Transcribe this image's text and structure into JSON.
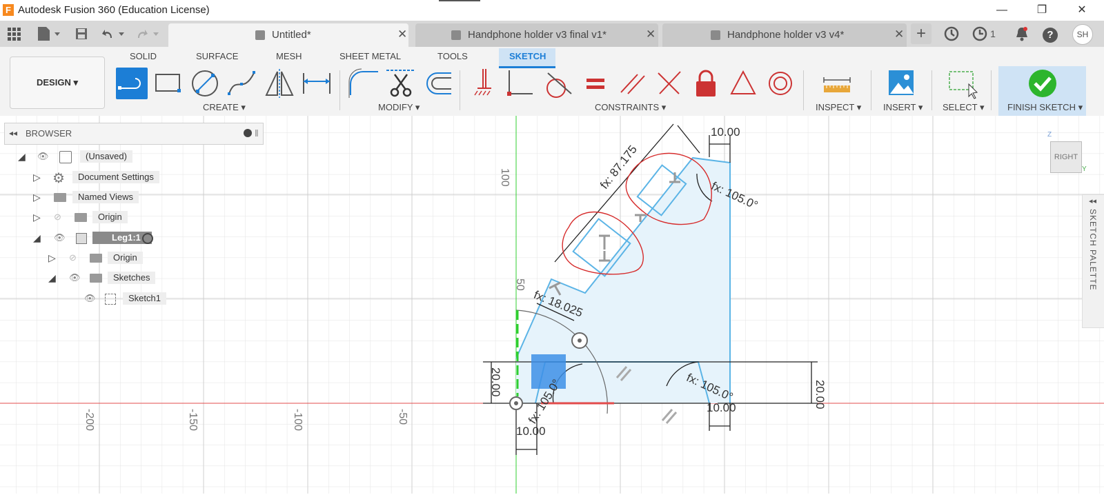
{
  "window": {
    "logo_letter": "F",
    "title": "Autodesk Fusion 360 (Education License)",
    "minimize": "—",
    "restore": "❐",
    "close": "✕"
  },
  "tabs": [
    {
      "label": "Untitled*",
      "active": true
    },
    {
      "label": "Handphone holder v3 final v1*",
      "active": false
    },
    {
      "label": "Handphone holder v3 v4*",
      "active": false
    }
  ],
  "tab_close": "✕",
  "right_icons": {
    "add": "+",
    "jobs_count": "1",
    "user_initials": "SH",
    "help": "?"
  },
  "workspace_button": "DESIGN ▾",
  "ribbon_tabs": [
    "SOLID",
    "SURFACE",
    "MESH",
    "SHEET METAL",
    "TOOLS",
    "SKETCH"
  ],
  "groups": {
    "create": "CREATE ▾",
    "modify": "MODIFY ▾",
    "constraints": "CONSTRAINTS ▾",
    "inspect": "INSPECT ▾",
    "insert": "INSERT ▾",
    "select": "SELECT ▾",
    "finish": "FINISH SKETCH ▾"
  },
  "browser": {
    "title": "BROWSER",
    "nodes": [
      {
        "label": "(Unsaved)"
      },
      {
        "label": "Document Settings"
      },
      {
        "label": "Named Views"
      },
      {
        "label": "Origin"
      },
      {
        "label": "Leg1:1"
      },
      {
        "label": "Origin"
      },
      {
        "label": "Sketches"
      },
      {
        "label": "Sketch1"
      }
    ]
  },
  "viewcube_label": "RIGHT",
  "viewcube_axes": {
    "z": "Z",
    "y": "Y"
  },
  "sketch_palette": "SKETCH PALETTE",
  "axis_labels": {
    "v100": "100",
    "v50": "50",
    "h_200": "-200",
    "h_150": "-150",
    "h_100": "-100",
    "h_50": "-50"
  },
  "dimensions": {
    "d_top_width": "10.00",
    "d_length": "fx: 87.175",
    "d_angle_top": "fx: 105.0°",
    "d_short": "fx: 18.025",
    "d_height_left": "20.00",
    "d_height_right": "20.00",
    "d_angle_left": "fx: 105.0°",
    "d_angle_right": "fx: 105.0°",
    "d_bottom_left": "10.00",
    "d_bottom_right": "10.00"
  },
  "colors": {
    "accent": "#1c7ed6",
    "sketch_line": "#5bb4e6",
    "profile_fill": "#e6f3fb",
    "annotation": "#d62b2b",
    "x_axis": "#e34b4b",
    "y_axis": "#2fcf2f"
  }
}
